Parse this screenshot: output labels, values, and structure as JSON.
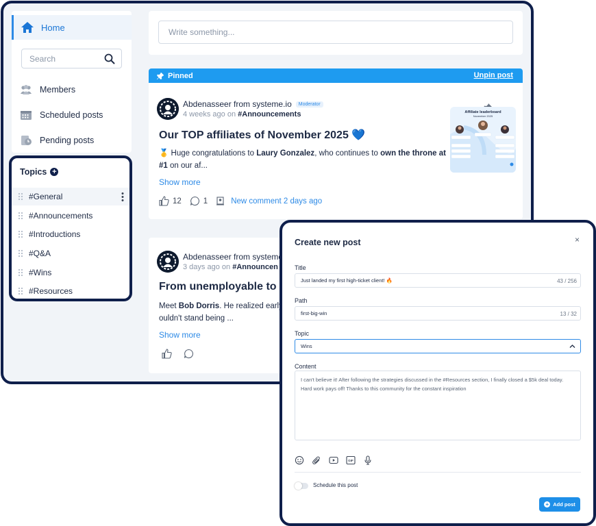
{
  "sidebar": {
    "home_label": "Home",
    "search_placeholder": "Search",
    "items": [
      {
        "label": "Members",
        "icon": "members-icon"
      },
      {
        "label": "Scheduled posts",
        "icon": "calendar-icon"
      },
      {
        "label": "Pending posts",
        "icon": "pending-icon"
      }
    ],
    "topics_title": "Topics",
    "topics": [
      "#General",
      "#Announcements",
      "#Introductions",
      "#Q&A",
      "#Wins",
      "#Resources"
    ]
  },
  "composer": {
    "placeholder": "Write something..."
  },
  "posts": [
    {
      "pinned_label": "Pinned",
      "unpin_label": "Unpin post",
      "author": "Abdenasseer from systeme.io",
      "badge": "Moderator",
      "time": "4 weeks ago",
      "on_word": "on",
      "topic": "#Announcements",
      "title": "Our TOP affiliates of November 2025",
      "title_emoji": "💙",
      "body_prefix": "🥇 Huge congratulations to ",
      "body_name": "Laury Gonzalez",
      "body_mid": ", who continues to ",
      "body_bold": "own the throne at #1",
      "body_suffix": " on our af...",
      "show_more": "Show more",
      "likes": "12",
      "comments": "1",
      "new_comment": "New comment 2 days ago",
      "thumbnail": {
        "title": "Affiliate leaderboard",
        "subtitle": "November 2025"
      }
    },
    {
      "author": "Abdenasseer from systeme",
      "time": "3 days ago",
      "on_word": "on",
      "topic": "#Announcen",
      "title": "From unemployable to a",
      "body_prefix": "Meet ",
      "body_name": "Bob Dorris",
      "body_mid": ". He realized early",
      "body_line2": "ouldn't stand being ...",
      "show_more": "Show more"
    }
  ],
  "modal": {
    "title": "Create new post",
    "close": "×",
    "title_label": "Title",
    "title_value": "Just landed my first high-ticket client! 🔥",
    "title_count": "43 / 256",
    "path_label": "Path",
    "path_value": "first-big-win",
    "path_count": "13 / 32",
    "topic_label": "Topic",
    "topic_value": "Wins",
    "content_label": "Content",
    "content_value": "I can't believe it! After following the strategies discussed in the #Resources section, I finally closed a $5k deal today. Hard work pays off! Thanks to this community for the constant inspiration",
    "schedule_label": "Schedule this post",
    "add_button": "Add post",
    "tools": [
      "emoji-icon",
      "attachment-icon",
      "video-icon",
      "gif-icon",
      "microphone-icon"
    ],
    "gif_text": "GIF"
  },
  "colors": {
    "accent": "#1e9bf0",
    "navy": "#0f1f4b",
    "link": "#2d8ae6"
  }
}
